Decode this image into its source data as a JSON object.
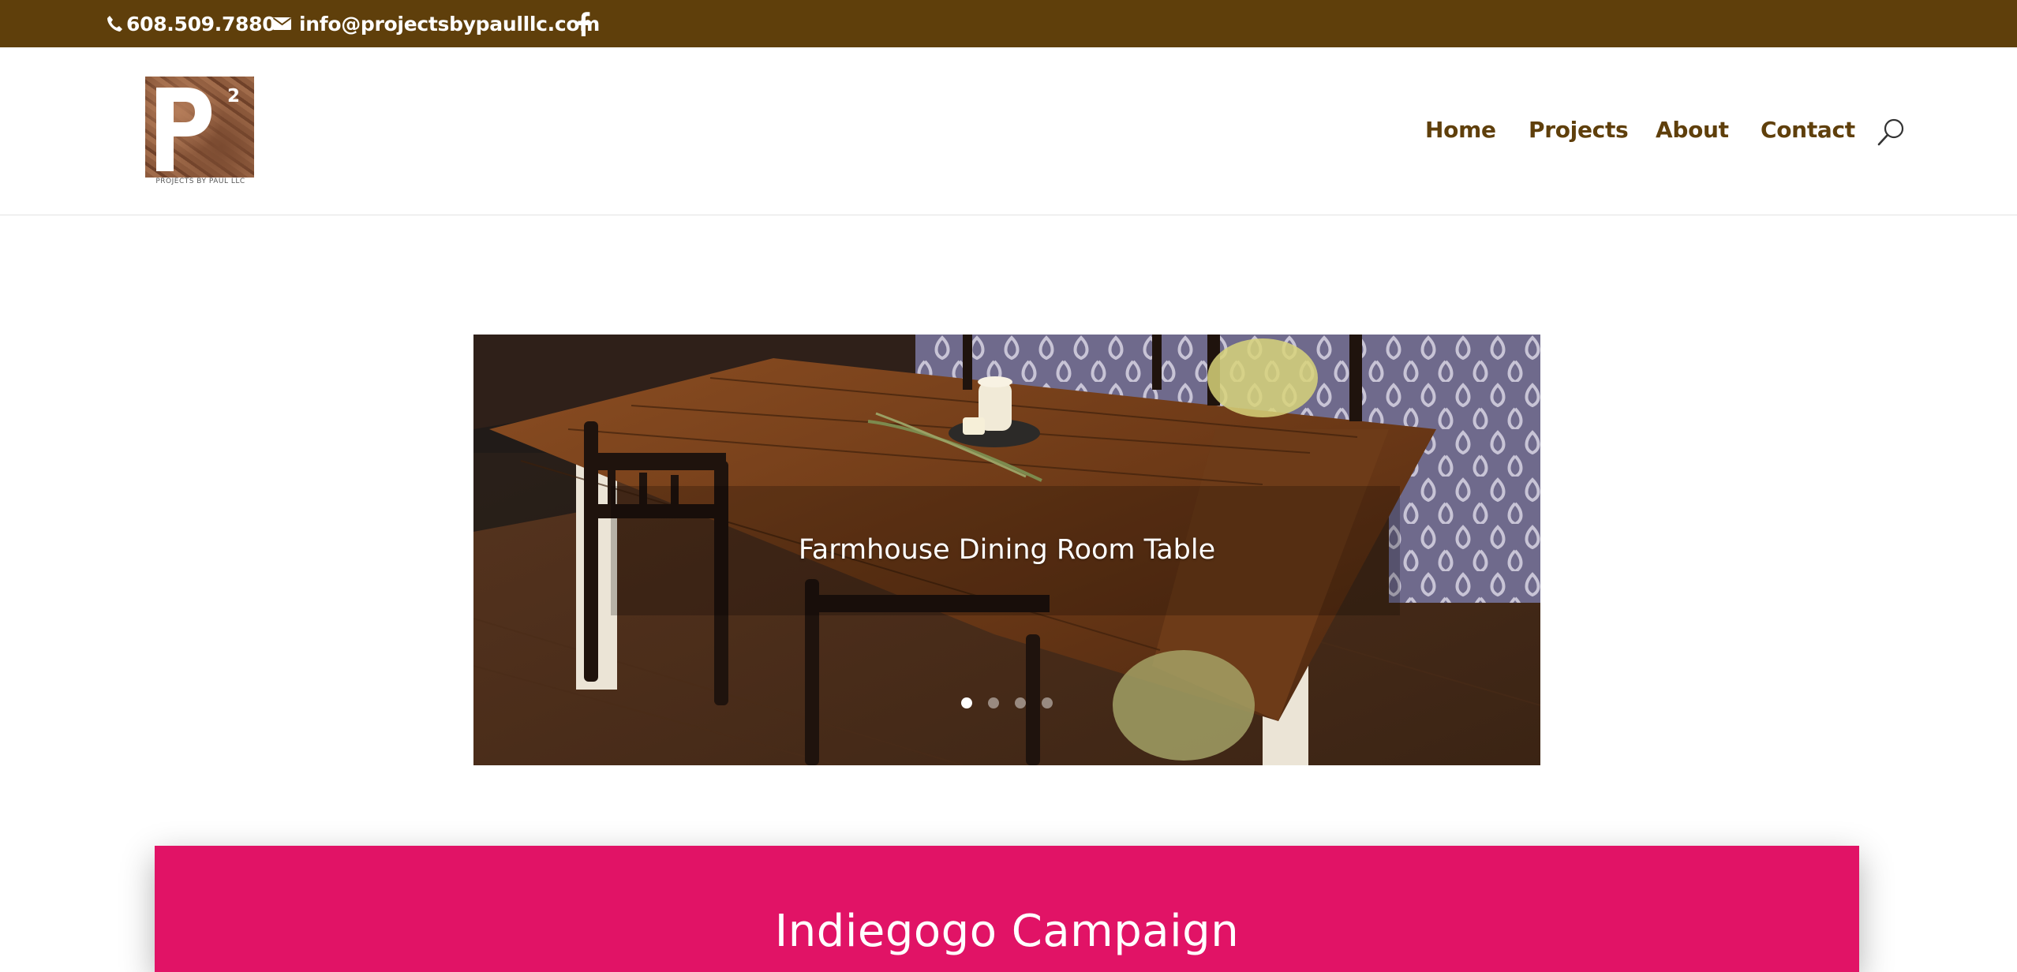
{
  "topbar": {
    "phone": "608.509.7880",
    "email": "info@projectsbypaulllc.com",
    "icons": {
      "phone": "phone-icon",
      "email": "envelope-icon",
      "social": "facebook-icon"
    },
    "color": "#5f3f0b"
  },
  "header": {
    "logo": {
      "mark": "P",
      "superscript": "2",
      "caption": "PROJECTS BY PAUL LLC"
    },
    "nav": [
      "Home",
      "Projects",
      "About",
      "Contact"
    ],
    "search_icon": "search-icon",
    "nav_color": "#5f3f0b"
  },
  "slider": {
    "caption": "Farmhouse Dining Room Table",
    "slide_count": 4,
    "active_index": 0
  },
  "campaign": {
    "title": "Indiegogo Campaign",
    "color": "#e11366"
  }
}
